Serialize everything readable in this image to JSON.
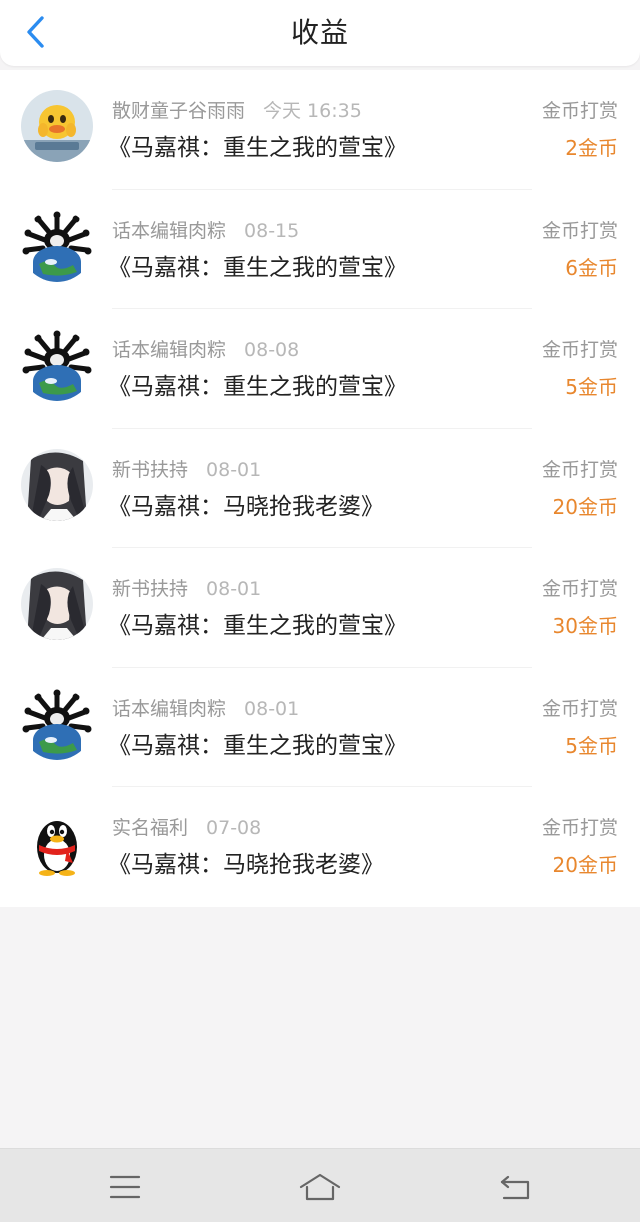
{
  "header": {
    "title": "收益"
  },
  "colors": {
    "accent_blue": "#2b8cf0",
    "amount_orange": "#e8872e"
  },
  "records": [
    {
      "sender": "散财童子谷雨雨",
      "time": "今天 16:35",
      "book": "《马嘉祺：重生之我的萱宝》",
      "type": "金币打赏",
      "amount": "2金币",
      "avatar": "duck-avatar"
    },
    {
      "sender": "话本编辑肉粽",
      "time": "08-15",
      "book": "《马嘉祺：重生之我的萱宝》",
      "type": "金币打赏",
      "amount": "6金币",
      "avatar": "globe-bones-avatar"
    },
    {
      "sender": "话本编辑肉粽",
      "time": "08-08",
      "book": "《马嘉祺：重生之我的萱宝》",
      "type": "金币打赏",
      "amount": "5金币",
      "avatar": "globe-bones-avatar"
    },
    {
      "sender": "新书扶持",
      "time": "08-01",
      "book": "《马嘉祺：马晓抢我老婆》",
      "type": "金币打赏",
      "amount": "20金币",
      "avatar": "anime-portrait-avatar"
    },
    {
      "sender": "新书扶持",
      "time": "08-01",
      "book": "《马嘉祺：重生之我的萱宝》",
      "type": "金币打赏",
      "amount": "30金币",
      "avatar": "anime-portrait-avatar"
    },
    {
      "sender": "话本编辑肉粽",
      "time": "08-01",
      "book": "《马嘉祺：重生之我的萱宝》",
      "type": "金币打赏",
      "amount": "5金币",
      "avatar": "globe-bones-avatar"
    },
    {
      "sender": "实名福利",
      "time": "07-08",
      "book": "《马嘉祺：马晓抢我老婆》",
      "type": "金币打赏",
      "amount": "20金币",
      "avatar": "penguin-avatar"
    }
  ],
  "navbar": {
    "icons": [
      "menu-icon",
      "home-icon",
      "return-icon"
    ]
  }
}
